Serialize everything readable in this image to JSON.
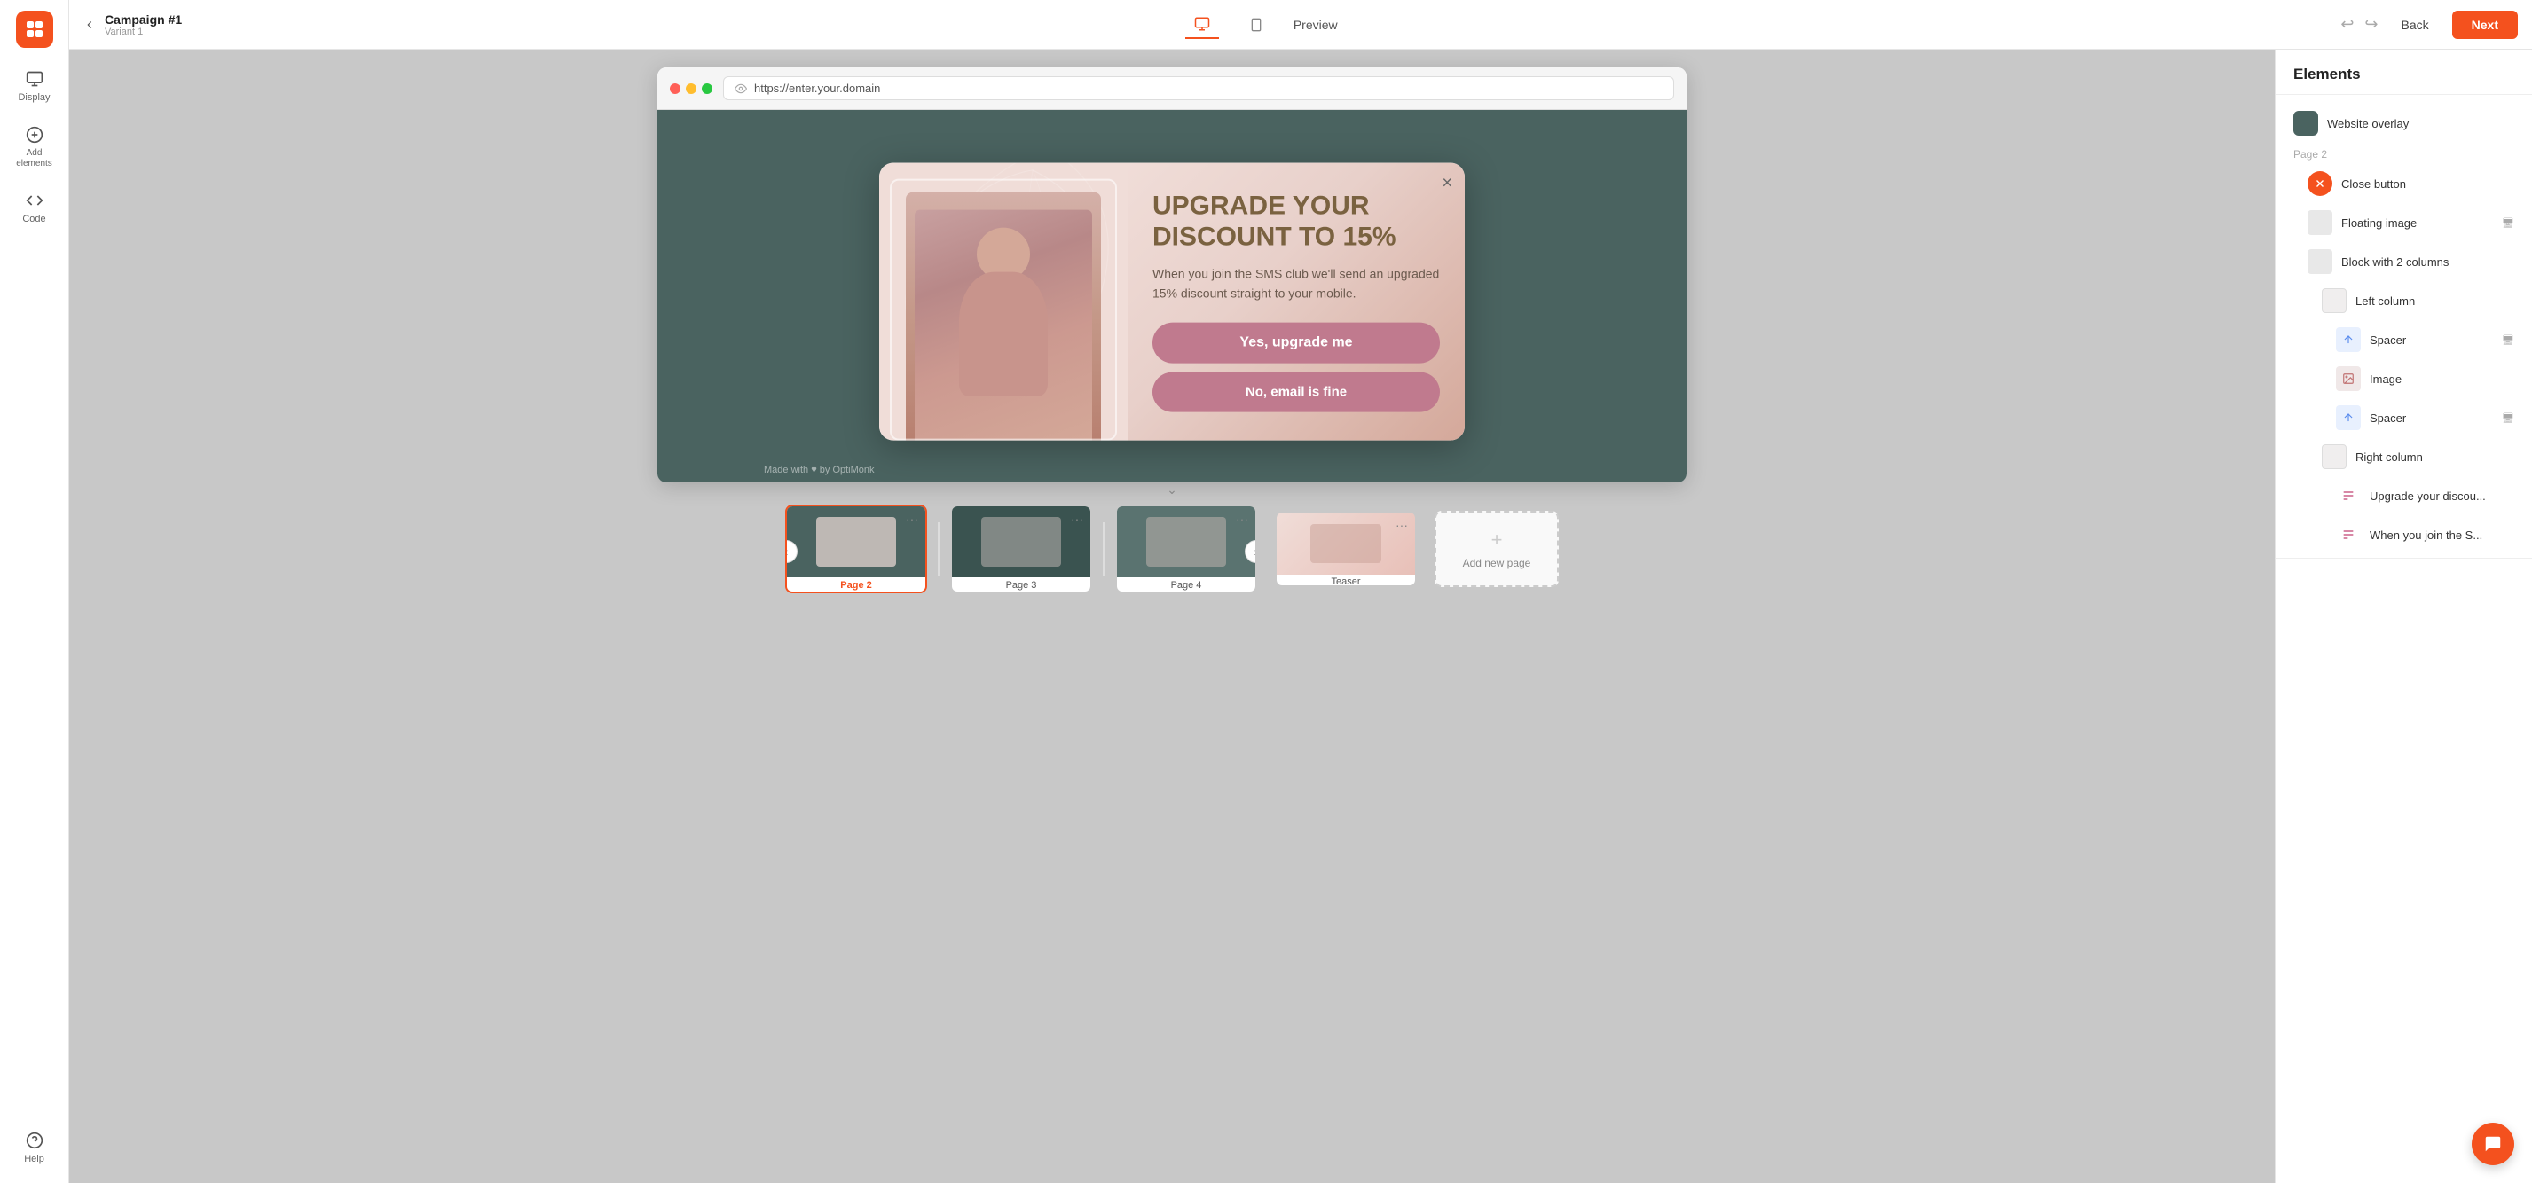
{
  "header": {
    "back_label": "Back",
    "next_label": "Next",
    "campaign_title": "Campaign #1",
    "campaign_sub": "Variant 1",
    "preview_label": "Preview",
    "address": "https://enter.your.domain"
  },
  "sidebar": {
    "items": [
      {
        "label": "Display",
        "icon": "monitor"
      },
      {
        "label": "Add elements",
        "icon": "plus-circle"
      },
      {
        "label": "Code",
        "icon": "code"
      },
      {
        "label": "Help",
        "icon": "help-circle"
      }
    ]
  },
  "popup": {
    "headline": "UPGRADE YOUR DISCOUNT TO 15%",
    "body": "When you join the SMS club we'll send an upgraded 15% discount straight to your mobile.",
    "btn_primary": "Yes, upgrade me",
    "btn_secondary": "No, email is fine",
    "footer": "Made with ♥ by OptiMonk"
  },
  "pages": [
    {
      "label": "Page 2",
      "active": true
    },
    {
      "label": "Page 3",
      "active": false
    },
    {
      "label": "Page 4",
      "active": false
    },
    {
      "label": "Teaser",
      "active": false
    }
  ],
  "add_page": "Add new page",
  "elements_panel": {
    "title": "Elements",
    "page_label": "Page 2",
    "items": [
      {
        "name": "Website overlay",
        "indent": 0,
        "type": "dark"
      },
      {
        "name": "Close button",
        "indent": 1,
        "type": "red-circle"
      },
      {
        "name": "Floating image",
        "indent": 1,
        "type": "white",
        "device": true
      },
      {
        "name": "Block with 2 columns",
        "indent": 1,
        "type": "grid"
      },
      {
        "name": "Left column",
        "indent": 2,
        "type": "sub"
      },
      {
        "name": "Spacer",
        "indent": 3,
        "type": "spacer",
        "device": true
      },
      {
        "name": "Image",
        "indent": 3,
        "type": "image"
      },
      {
        "name": "Spacer",
        "indent": 3,
        "type": "spacer",
        "device": true
      },
      {
        "name": "Right column",
        "indent": 2,
        "type": "sub"
      },
      {
        "name": "Upgrade your discou...",
        "indent": 3,
        "type": "text"
      },
      {
        "name": "When you join the S...",
        "indent": 3,
        "type": "text"
      }
    ]
  },
  "icons": {
    "monitor": "⬜",
    "plus": "+",
    "code": "<>",
    "help": "?",
    "eye": "👁",
    "chevron_down": "⌄",
    "chevron_left": "‹",
    "chevron_right": "›",
    "close": "×",
    "undo": "↩",
    "redo": "↪",
    "dots": "···",
    "chat": "💬"
  }
}
